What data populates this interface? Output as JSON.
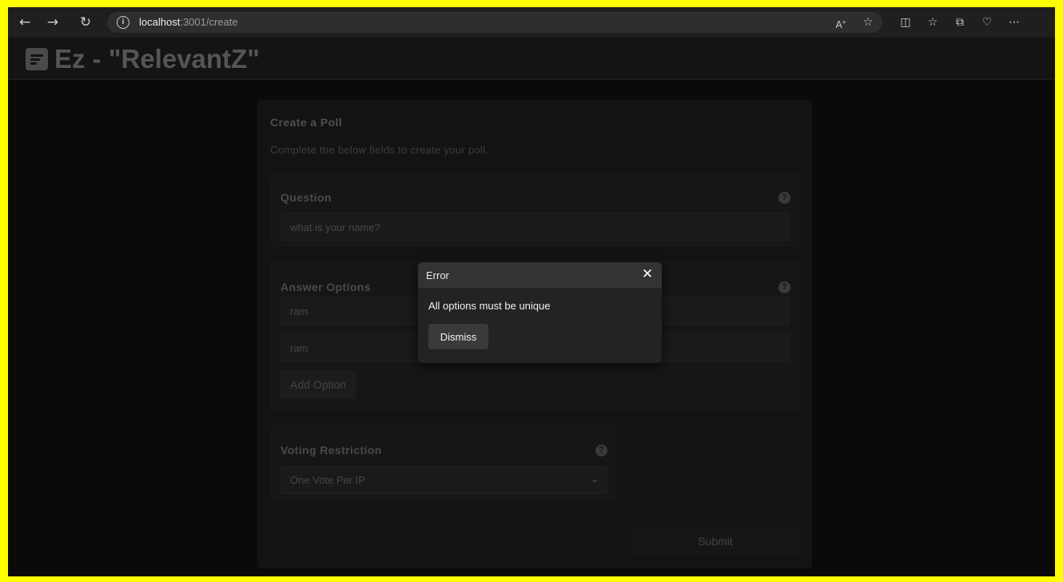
{
  "browser": {
    "url_host": "localhost",
    "url_path": ":3001/create"
  },
  "app": {
    "title": "Ez - \"RelevantZ\""
  },
  "form": {
    "title": "Create a Poll",
    "subtitle": "Complete the below fields to create your poll.",
    "question": {
      "label": "Question",
      "value": "what is your name?"
    },
    "answers": {
      "label": "Answer Options",
      "options": [
        "ram",
        "ram"
      ],
      "add_label": "Add Option"
    },
    "restriction": {
      "label": "Voting Restriction",
      "value": "One Vote Per IP"
    },
    "submit_label": "Submit"
  },
  "modal": {
    "title": "Error",
    "message": "All options must be unique",
    "dismiss_label": "Dismiss",
    "close_glyph": "✕"
  },
  "colors": {
    "highlight_border": "#ffff00",
    "background": "#0a0a0a",
    "modal_header": "#333333"
  }
}
